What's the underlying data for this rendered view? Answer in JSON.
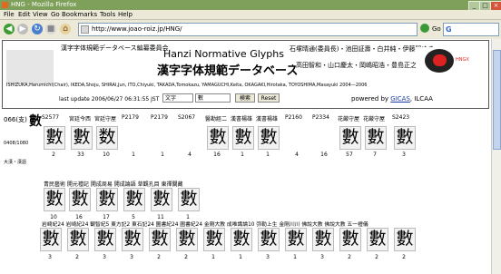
{
  "window": {
    "title": "HNG - Mozilla Firefox"
  },
  "menu": [
    "File",
    "Edit",
    "View",
    "Go",
    "Bookmarks",
    "Tools",
    "Help"
  ],
  "nav": {
    "url": "http://www.joao-roiz.jp/HNG/",
    "go_label": "Go",
    "search_engine": "G"
  },
  "header": {
    "committee": "漢字字体規範データベース編纂委員会",
    "title_en": "Hanzi Normative Glyphs",
    "title_jp": "漢字字体規範データベース",
    "right_line1": "石塚晴通(委員長)・池田証壽・白井純・伊藤智ゆき",
    "right_line2": "・高田智和・山口慶太・岡嶋昭浩・豊島正之",
    "crest_text": "HNGX",
    "members": "ISHIZUKA,Harumichi(Chair), IKEDA,Shoju, SHIRAI,Jun, ITO,Chiyuki, TAKADA,Tomokazu, YAMAGUCHI,Keita, OKAGAKI,Hirotaka, TOYOSHIMA,Masayuki 2004—2006",
    "last_update": "last update 2006/06/27 06:31:55 JST",
    "select_value": "文字",
    "input_value": "數",
    "search_btn": "検索",
    "reset_btn": "Reset",
    "powered_prefix": "powered by ",
    "powered_link": "GICAS",
    "powered_suffix": ", ILCAA"
  },
  "entry": {
    "code": "066(支)",
    "char": "數",
    "small1": "0408/1080",
    "small2": "大漢・漢語"
  },
  "row1": {
    "labels": [
      "S2577",
      "宮廷今西",
      "宮廷守屋",
      "P2179",
      "P2179",
      "S2067",
      "醫勘經二",
      "漢書楊雄",
      "漢書楊雄",
      "P2160",
      "P2334",
      "花厳守屋",
      "花厳守屋",
      "S2423"
    ],
    "glyphs": [
      "數",
      "數",
      "数",
      "",
      "",
      "",
      "數",
      "數",
      "數",
      "",
      "",
      "數",
      "數",
      "數"
    ],
    "counts": [
      "2",
      "33",
      "10",
      "1",
      "1",
      "4",
      "16",
      "1",
      "1",
      "4",
      "16",
      "57",
      "7",
      "3"
    ]
  },
  "row2": {
    "label": "青民藝術 開元禮記 開成周易 開成論語 草觀孔目 東禪關藏",
    "glyphs": [
      "數",
      "數",
      "數",
      "數",
      "數",
      "數"
    ],
    "counts": [
      "10",
      "16",
      "17",
      "5",
      "11",
      "1"
    ]
  },
  "row3": {
    "label": "岩崎紀24 岩崎紀24 観智紀5 東方記2 東石記24 圖書紀24 圖書紀24 金剛大教 成唯識論10 弥勒上生 金剛川川 佛說大教 佛說大教 五一禮儀",
    "glyphs": [
      "數",
      "數",
      "數",
      "數",
      "數",
      "數",
      "數",
      "數",
      "數",
      "數",
      "數",
      "數",
      "數",
      "數"
    ],
    "counts": [
      "3",
      "2",
      "3",
      "3",
      "2",
      "2",
      "1",
      "1",
      "3",
      "1",
      "3",
      "2",
      "2",
      "2"
    ]
  }
}
